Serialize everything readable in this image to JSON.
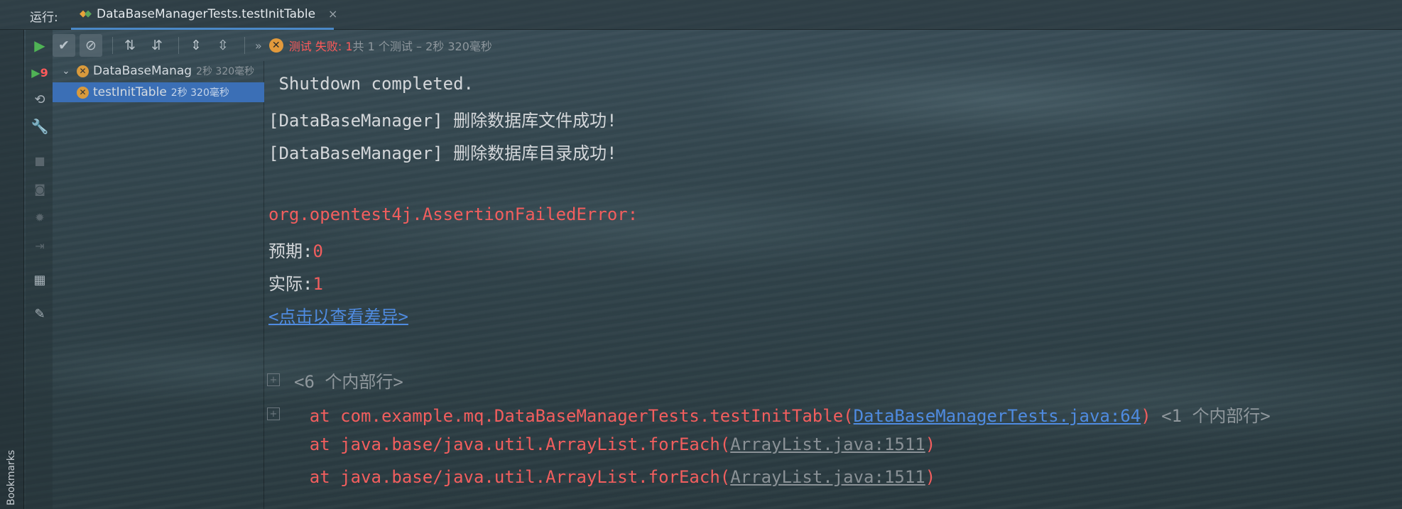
{
  "run_panel": {
    "label": "运行:",
    "tab_title": "DataBaseManagerTests.testInitTable",
    "close_glyph": "×"
  },
  "left_strip": {
    "bookmarks_label": "Bookmarks"
  },
  "action_column": {
    "rerun_badge": "9"
  },
  "toolbar": {
    "status_fail": "测试 失败: 1",
    "status_rest": "共 1 个测试 – 2秒 320毫秒",
    "overflow": "»"
  },
  "tree": {
    "suite": {
      "name": "DataBaseManag",
      "time": "2秒 320毫秒"
    },
    "test": {
      "name": "testInitTable",
      "time": "2秒 320毫秒"
    }
  },
  "console": {
    "line1": " Shutdown completed.",
    "line2": "[DataBaseManager] 删除数据库文件成功!",
    "line3": "[DataBaseManager] 删除数据库目录成功!",
    "error_class": "org.opentest4j.AssertionFailedError:",
    "expected_label": "预期:",
    "expected_value": "0",
    "actual_label": "实际:",
    "actual_value": "1",
    "diff_link": "<点击以查看差异>",
    "internal_lines_6": "<6 个内部行>",
    "frame1_prefix": "    at com.example.mq.DataBaseManagerTests.testInitTable(",
    "frame1_link": "DataBaseManagerTests.java:64",
    "frame1_suffix": ")",
    "frame1_internal": " <1 个内部行>",
    "frame2_prefix": "    at java.base/java.util.ArrayList.forEach(",
    "frame2_link": "ArrayList.java:1511",
    "frame2_suffix": ")",
    "frame3_prefix": "    at java.base/java.util.ArrayList.forEach(",
    "frame3_link": "ArrayList.java:1511",
    "frame3_suffix": ")"
  },
  "colors": {
    "error": "#f25e5e",
    "link": "#4f8be0",
    "selection": "#3b6fb6",
    "fail_badge": "#e39a3c",
    "play_green": "#4fb355"
  },
  "icons": {
    "run": "play-icon",
    "rerun_failed": "rerun-failed-icon",
    "toggle_auto_test": "toggle-auto-test-icon",
    "settings": "wrench-icon",
    "stop": "stop-icon",
    "screenshot": "camera-icon",
    "debug": "bug-icon",
    "exit": "exit-icon",
    "layout": "layout-icon",
    "pin": "pin-icon"
  }
}
